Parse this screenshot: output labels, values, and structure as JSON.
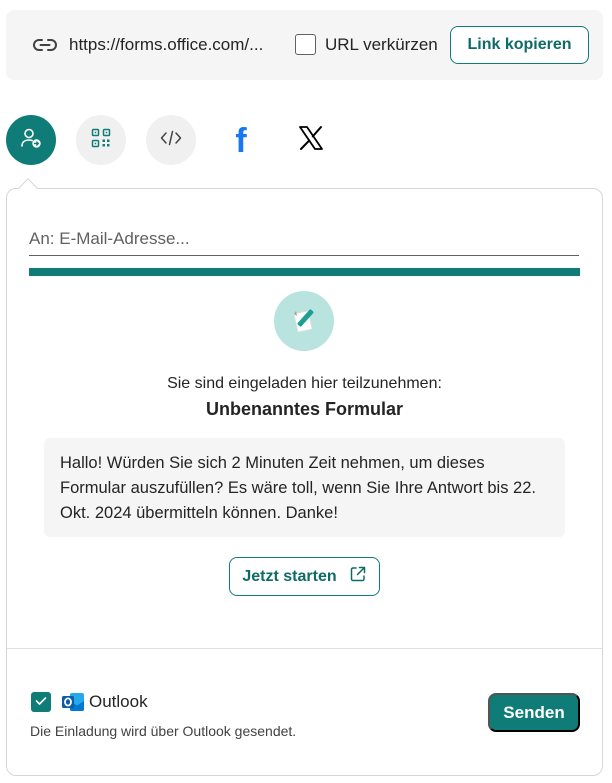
{
  "link_bar": {
    "url": "https://forms.office.com/...",
    "shorten_label": "URL verkürzen",
    "shorten_checked": false,
    "copy_button": "Link kopieren"
  },
  "share_methods": [
    {
      "icon": "invite-person-icon",
      "selected": true
    },
    {
      "icon": "qr-code-icon",
      "selected": false
    },
    {
      "icon": "embed-code-icon",
      "selected": false
    },
    {
      "icon": "facebook-icon",
      "selected": false
    },
    {
      "icon": "x-twitter-icon",
      "selected": false
    }
  ],
  "email": {
    "placeholder": "An: E-Mail-Adresse...",
    "value": ""
  },
  "invitation": {
    "intro": "Sie sind eingeladen hier teilzunehmen:",
    "form_title": "Unbenanntes Formular",
    "message": "Hallo! Würden Sie sich 2 Minuten Zeit nehmen, um dieses Formular auszufüllen? Es wäre toll, wenn Sie Ihre Antwort bis 22. Okt. 2024 übermitteln können. Danke!",
    "start_button": "Jetzt starten"
  },
  "footer": {
    "outlook_label": "Outlook",
    "outlook_checked": true,
    "note": "Die Einladung wird über Outlook gesendet.",
    "send_button": "Senden"
  },
  "colors": {
    "accent": "#0f7c78",
    "facebook": "#1877f2"
  }
}
